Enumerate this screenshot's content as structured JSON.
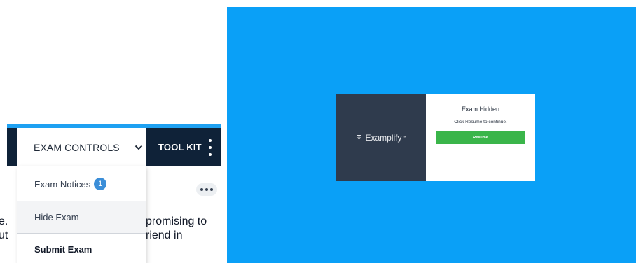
{
  "navbar": {
    "exam_controls_label": "EXAM CONTROLS",
    "toolkit_label": "TOOL KIT"
  },
  "dropdown": {
    "notices_label": "Exam Notices",
    "notices_count": "1",
    "hide_label": "Hide Exam",
    "submit_label": "Submit Exam"
  },
  "background_text": {
    "line1_left": "e.",
    "line2_left": "ut",
    "line1_right": "promising to",
    "line2_right": "riend in"
  },
  "hidden_screen": {
    "brand_name": "Examplify",
    "title": "Exam Hidden",
    "subtitle": "Click Resume to continue.",
    "resume_label": "Resume"
  },
  "colors": {
    "navbar_bg": "#0f2238",
    "accent_strip": "#1ea1f2",
    "badge": "#3b8ed8",
    "screen_bg": "#0aa0f7",
    "card_dark": "#2f3b4d",
    "resume_green": "#3ab54a"
  },
  "icons": {
    "exam_controls": "chevron-down-icon",
    "toolkit": "kebab-menu-icon",
    "more": "more-horizontal-icon",
    "brand": "examplify-logo-icon"
  }
}
